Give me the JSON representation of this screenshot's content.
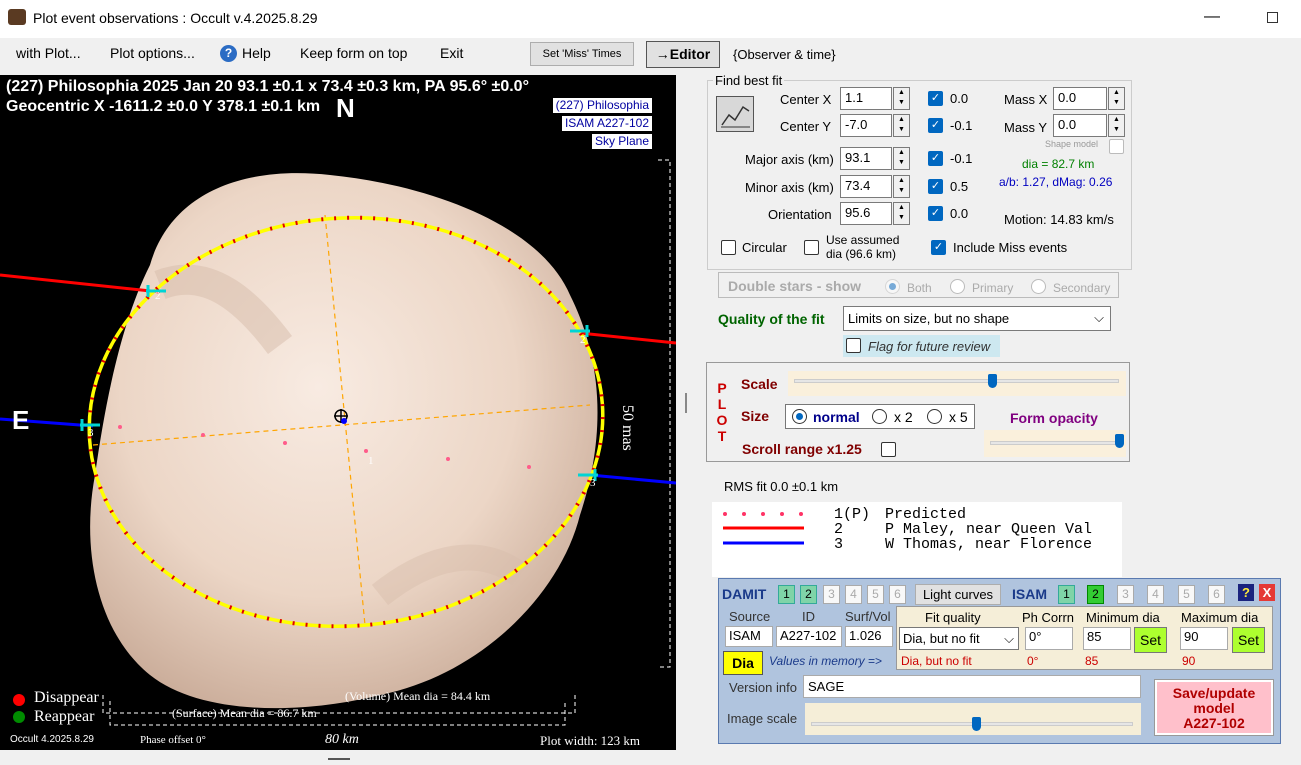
{
  "window": {
    "title": "Plot event observations : Occult v.4.2025.8.29",
    "min_icon": "minimize-icon",
    "max_icon": "maximize-icon"
  },
  "menu": {
    "with_plot": "with Plot...",
    "plot_options": "Plot options...",
    "help": "Help",
    "keep_on_top": "Keep form on top",
    "exit": "Exit",
    "set_miss_times": "Set 'Miss' Times",
    "editor": "→Editor",
    "observer_time": "{Observer & time}"
  },
  "plot": {
    "header1": "(227) Philosophia  2025 Jan 20  93.1 ±0.1 x 73.4 ±0.3 km, PA 95.6° ±0.0°",
    "header2": "Geocentric  X  -1611.2 ±0.0  Y 378.1 ±0.1 km",
    "north": "N",
    "east": "E",
    "legend": [
      "(227) Philosophia",
      "ISAM A227-102",
      "Sky Plane"
    ],
    "scale_label": "50 mas",
    "chord_labels": [
      "2",
      "2",
      "3",
      "3",
      "1"
    ],
    "disappear": "Disappear",
    "reappear": "Reappear",
    "volume_dia": "(Volume) Mean dia = 84.4 km",
    "surface_dia": "(Surface) Mean dia = 86.7 km",
    "version": "Occult 4.2025.8.29",
    "phase_offset": "Phase offset 0°",
    "scalebar": "80 km",
    "plot_width": "Plot width: 123 km",
    "colors": {
      "ellipse": "#ffff00",
      "chord_p_maley": "#ff0000",
      "chord_w_thomas": "#0000ff",
      "predicted": "#ff3366"
    }
  },
  "fit": {
    "group_title": "Find best fit",
    "center_x_label": "Center X",
    "center_x": "1.1",
    "center_x_delta": "0.0",
    "center_y_label": "Center Y",
    "center_y": "-7.0",
    "center_y_delta": "-0.1",
    "major_label": "Major axis (km)",
    "major": "93.1",
    "major_delta": "-0.1",
    "minor_label": "Minor axis (km)",
    "minor": "73.4",
    "minor_delta": "0.5",
    "orient_label": "Orientation",
    "orient": "95.6",
    "orient_delta": "0.0",
    "mass_x_label": "Mass X",
    "mass_x": "0.0",
    "mass_y_label": "Mass Y",
    "mass_y": "0.0",
    "shape_model": "Shape model",
    "dia": "dia = 82.7 km",
    "ab": "a/b: 1.27, dMag: 0.26",
    "motion": "Motion: 14.83 km/s",
    "circular": "Circular",
    "use_assumed": "Use assumed",
    "use_assumed2": "dia (96.6 km)",
    "include_miss": "Include Miss events",
    "double_stars": "Double stars - show",
    "both": "Both",
    "primary": "Primary",
    "secondary": "Secondary",
    "quality_label": "Quality of the fit",
    "quality_value": "Limits on size, but no shape",
    "flag_review": "Flag for future review"
  },
  "plotpanel": {
    "plot_letters": [
      "P",
      "L",
      "O",
      "T"
    ],
    "scale": "Scale",
    "scale_level": 0.6,
    "size": "Size",
    "normal": "normal",
    "x2": "x 2",
    "x5": "x 5",
    "form_opacity": "Form opacity",
    "opacity_level": 0.98,
    "scroll_range": "Scroll range x1.25"
  },
  "rms": "RMS fit 0.0 ±0.1 km",
  "chords": [
    {
      "num": "1(P)",
      "name": "Predicted",
      "color": "#ff3366"
    },
    {
      "num": "2",
      "name": "P Maley, near Queen Val",
      "color": "#ff0000"
    },
    {
      "num": "3",
      "name": "W Thomas, near Florence",
      "color": "#0000ff"
    }
  ],
  "shape": {
    "damit": "DAMIT",
    "damit_nums": [
      "1",
      "2",
      "3",
      "4",
      "5",
      "6"
    ],
    "light_curves": "Light curves",
    "isam": "ISAM",
    "isam_nums": [
      "1",
      "2",
      "3",
      "4",
      "5",
      "6"
    ],
    "help_q": "?",
    "close_x": "X",
    "source_h": "Source",
    "id_h": "ID",
    "surfvol_h": "Surf/Vol",
    "source": "ISAM",
    "id": "A227-102",
    "surfvol": "1.026",
    "fitq_h": "Fit quality",
    "phcorr_h": "Ph Corrn",
    "mindia_h": "Minimum dia",
    "maxdia_h": "Maximum dia",
    "fitq": "Dia, but no fit",
    "phcorr": "0°",
    "mindia": "85",
    "maxdia": "90",
    "set": "Set",
    "dia_btn": "Dia",
    "values_mem": "Values in memory =>",
    "mem_fitq": "Dia, but no fit",
    "mem_ph": "0°",
    "mem_min": "85",
    "mem_max": "90",
    "version_label": "Version info",
    "version": "SAGE",
    "image_scale": "Image scale",
    "image_scale_level": 0.5,
    "save_btn": "Save/update model A227-102",
    "save1": "Save/update",
    "save2": "model",
    "save3": "A227-102"
  }
}
